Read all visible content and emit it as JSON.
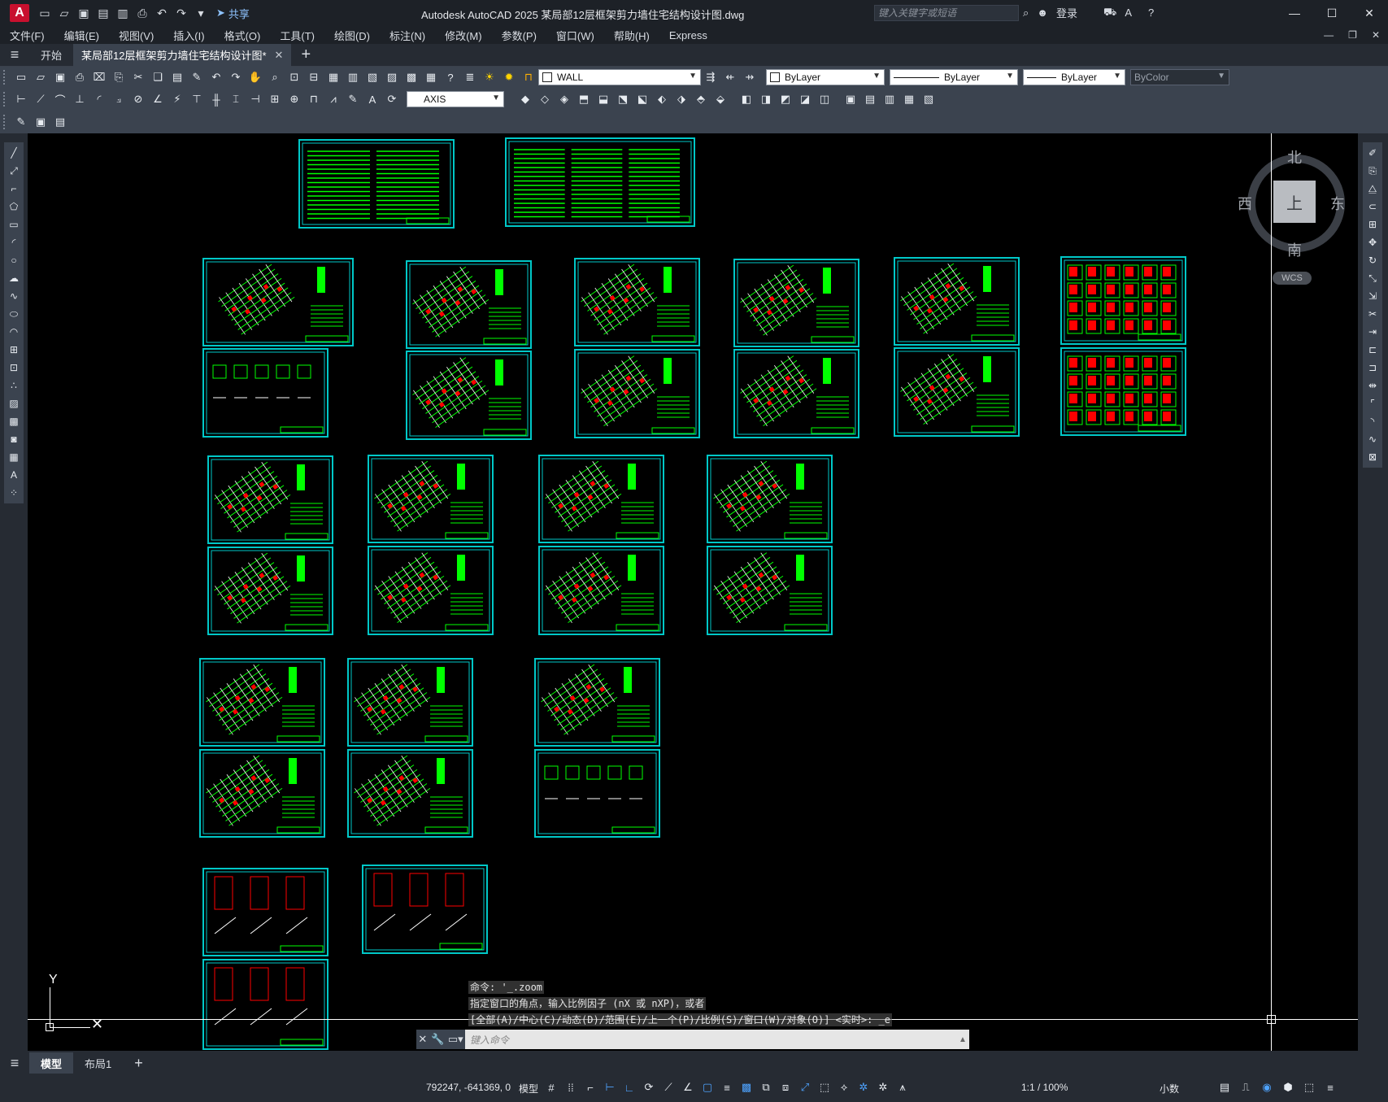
{
  "titlebar": {
    "app_logo": "A",
    "share_label": "共享",
    "title": "Autodesk AutoCAD 2025    某局部12层框架剪力墙住宅结构设计图.dwg",
    "search_placeholder": "键入关键字或短语",
    "login_label": "登录"
  },
  "menu": [
    "文件(F)",
    "编辑(E)",
    "视图(V)",
    "插入(I)",
    "格式(O)",
    "工具(T)",
    "绘图(D)",
    "标注(N)",
    "修改(M)",
    "参数(P)",
    "窗口(W)",
    "帮助(H)",
    "Express"
  ],
  "tabs": {
    "start": "开始",
    "document": "某局部12层框架剪力墙住宅结构设计图*"
  },
  "toolbar": {
    "layer": "WALL",
    "color": "ByLayer",
    "linetype": "ByLayer",
    "lineweight": "ByLayer",
    "plotstyle": "ByColor",
    "dimstyle": "AXIS"
  },
  "viewcube": {
    "north": "北",
    "south": "南",
    "east": "东",
    "west": "西",
    "top_face": "上",
    "wcs": "WCS"
  },
  "ucs": {
    "x_label": "X",
    "y_label": "Y"
  },
  "command": {
    "history": [
      "命令: '_.zoom",
      "指定窗口的角点，输入比例因子 (nX 或 nXP)，或者",
      "[全部(A)/中心(C)/动态(D)/范围(E)/上一个(P)/比例(S)/窗口(W)/对象(O)] <实时>: _e"
    ],
    "placeholder": "键入命令"
  },
  "layout_tabs": [
    "模型",
    "布局1"
  ],
  "status": {
    "coords": "792247, -641369, 0",
    "mode": "模型",
    "scale": "1:1 / 100%",
    "units": "小数"
  },
  "colors": {
    "sheet_border": "#00c8c8",
    "drawing_green": "#00ff00",
    "drawing_red": "#ff0000",
    "background": "#000000"
  }
}
